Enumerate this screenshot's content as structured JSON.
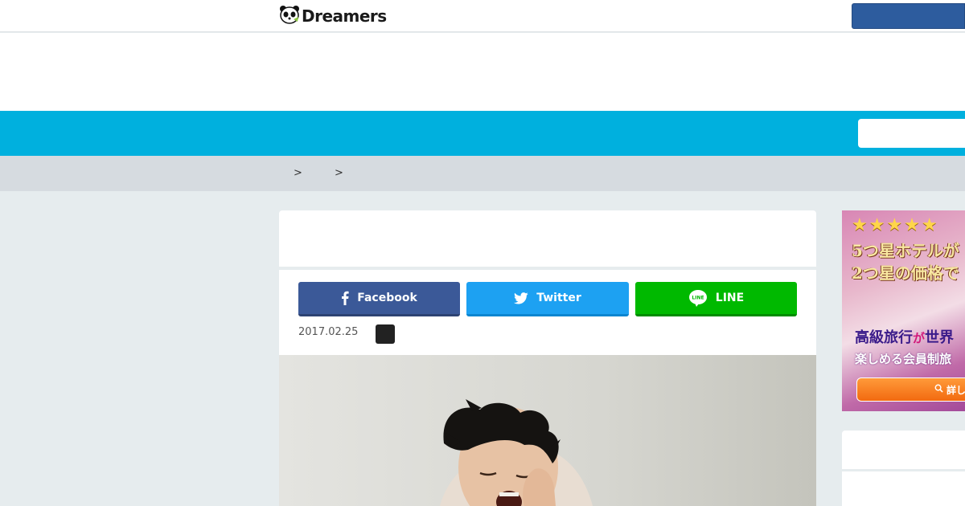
{
  "header": {
    "logo_text": "Dreamers",
    "logo_icon": "panda-icon"
  },
  "breadcrumb": {
    "separators": [
      ">",
      ">"
    ]
  },
  "share": {
    "facebook_label": "Facebook",
    "twitter_label": "Twitter",
    "line_label": "LINE",
    "line_icon_text": "LINE"
  },
  "article": {
    "date": "2017.02.25"
  },
  "sidebar_ad": {
    "stars": "★★★★★",
    "line1": "5つ星ホテルが",
    "line2": "2つ星の価格で",
    "line3_a": "高級旅行",
    "line3_b": "が",
    "line3_c": "世界",
    "line4": "楽しめる会員制旅",
    "button_label": "詳し"
  },
  "colors": {
    "nav_blue": "#00b0de",
    "facebook": "#3b5998",
    "twitter": "#1da1f2",
    "line": "#00b900"
  }
}
